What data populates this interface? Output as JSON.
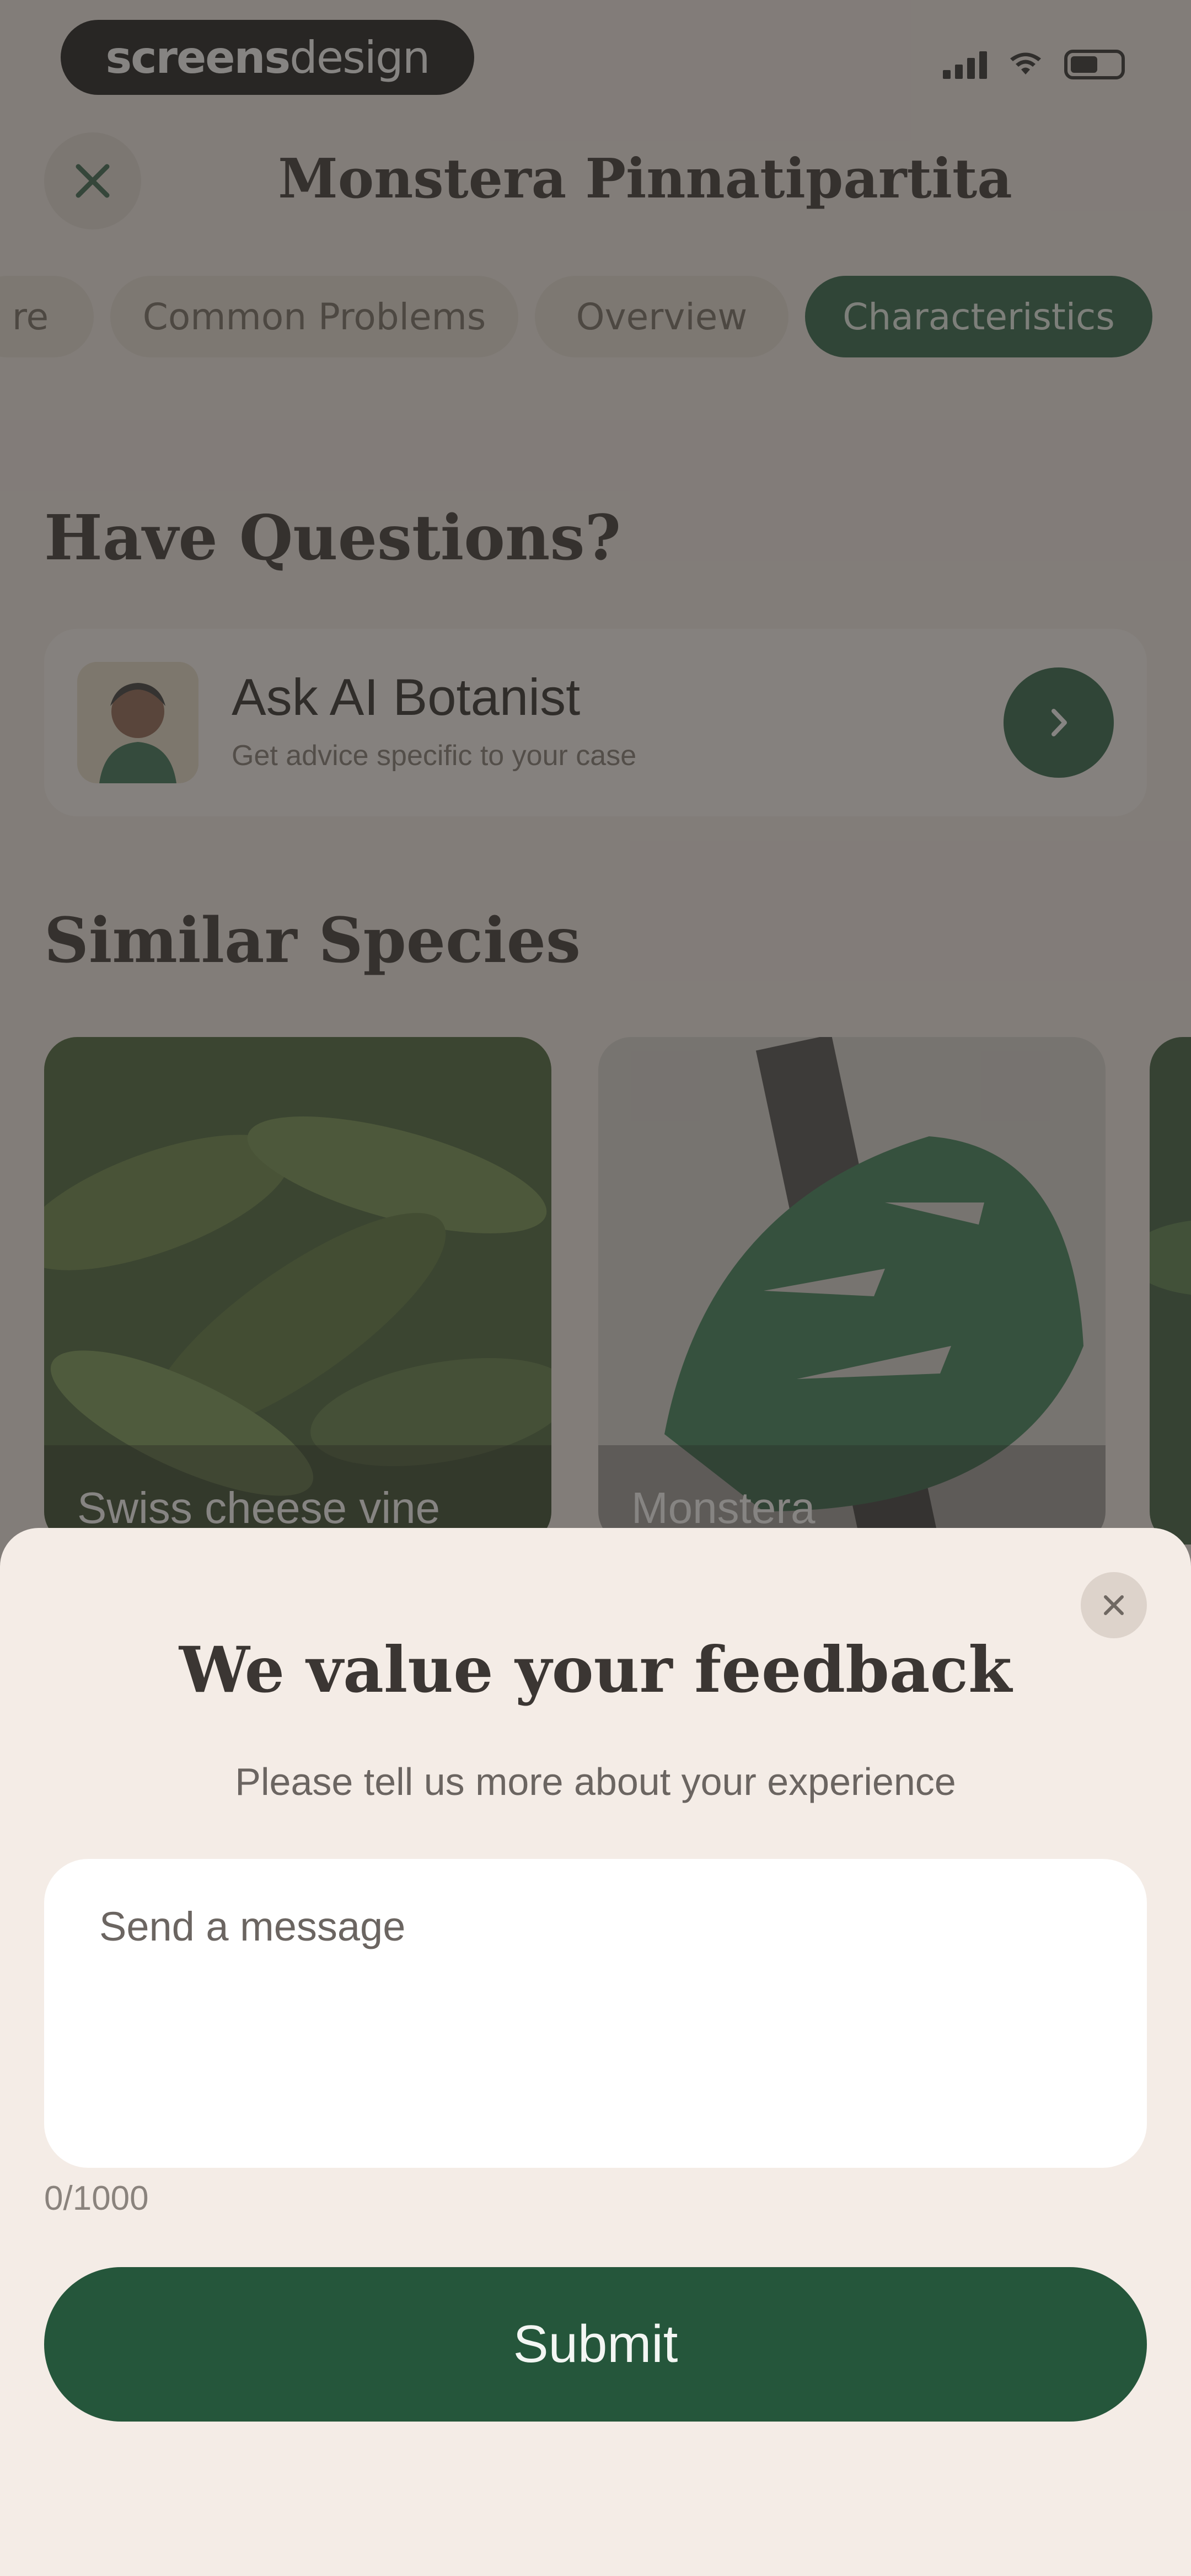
{
  "status_bar": {
    "brand_bold": "screens",
    "brand_light": "design"
  },
  "header": {
    "title": "Monstera Pinnatipartita",
    "close_icon": "close-icon"
  },
  "tabs": [
    {
      "label": "re",
      "active": false
    },
    {
      "label": "Common Problems",
      "active": false
    },
    {
      "label": "Overview",
      "active": false
    },
    {
      "label": "Characteristics",
      "active": true
    }
  ],
  "questions": {
    "heading": "Have Questions?",
    "card_title": "Ask AI Botanist",
    "card_sub": "Get advice specific to your case",
    "go_icon": "chevron-right-icon"
  },
  "similar": {
    "heading": "Similar Species",
    "items": [
      {
        "label": "Swiss cheese vine"
      },
      {
        "label": "Monstera"
      },
      {
        "label": ""
      }
    ]
  },
  "feedback": {
    "title": "We value your feedback",
    "subtitle": "Please tell us more about your experience",
    "placeholder": "Send a message",
    "counter": "0/1000",
    "submit": "Submit"
  },
  "colors": {
    "accent": "#1f5a3c",
    "sheet_bg": "#f4ece6"
  }
}
